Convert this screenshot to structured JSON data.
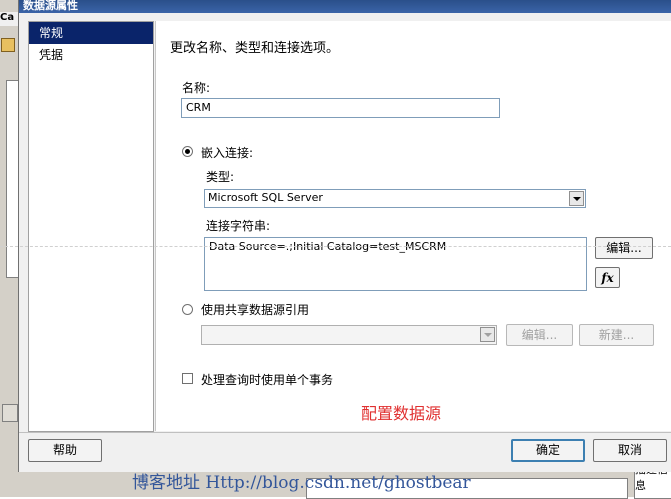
{
  "background": {
    "left_tab": "Ca",
    "right_box_text": "描述信息"
  },
  "dialog": {
    "title": "数据源属性",
    "nav": [
      {
        "label": "常规",
        "selected": true
      },
      {
        "label": "凭据",
        "selected": false
      }
    ],
    "heading": "更改名称、类型和连接选项。",
    "name_label": "名称:",
    "name_value": "CRM",
    "embedded_radio_label": "嵌入连接:",
    "type_label": "类型:",
    "type_value": "Microsoft SQL Server",
    "conn_label": "连接字符串:",
    "conn_value": "Data Source=.;Initial Catalog=test_MSCRM",
    "edit_button": "编辑...",
    "fx_button": "fx",
    "shared_radio_label": "使用共享数据源引用",
    "shared_edit_button": "编辑...",
    "shared_new_button": "新建...",
    "single_txn_label": "处理查询时使用单个事务",
    "annotation": "配置数据源",
    "help_button": "帮助",
    "ok_button": "确定",
    "cancel_button": "取消"
  },
  "watermark": "博客地址 Http://blog.csdn.net/ghostbear",
  "colors": {
    "selection": "#0a246a",
    "annotation": "#e03030",
    "watermark": "#33569a"
  }
}
